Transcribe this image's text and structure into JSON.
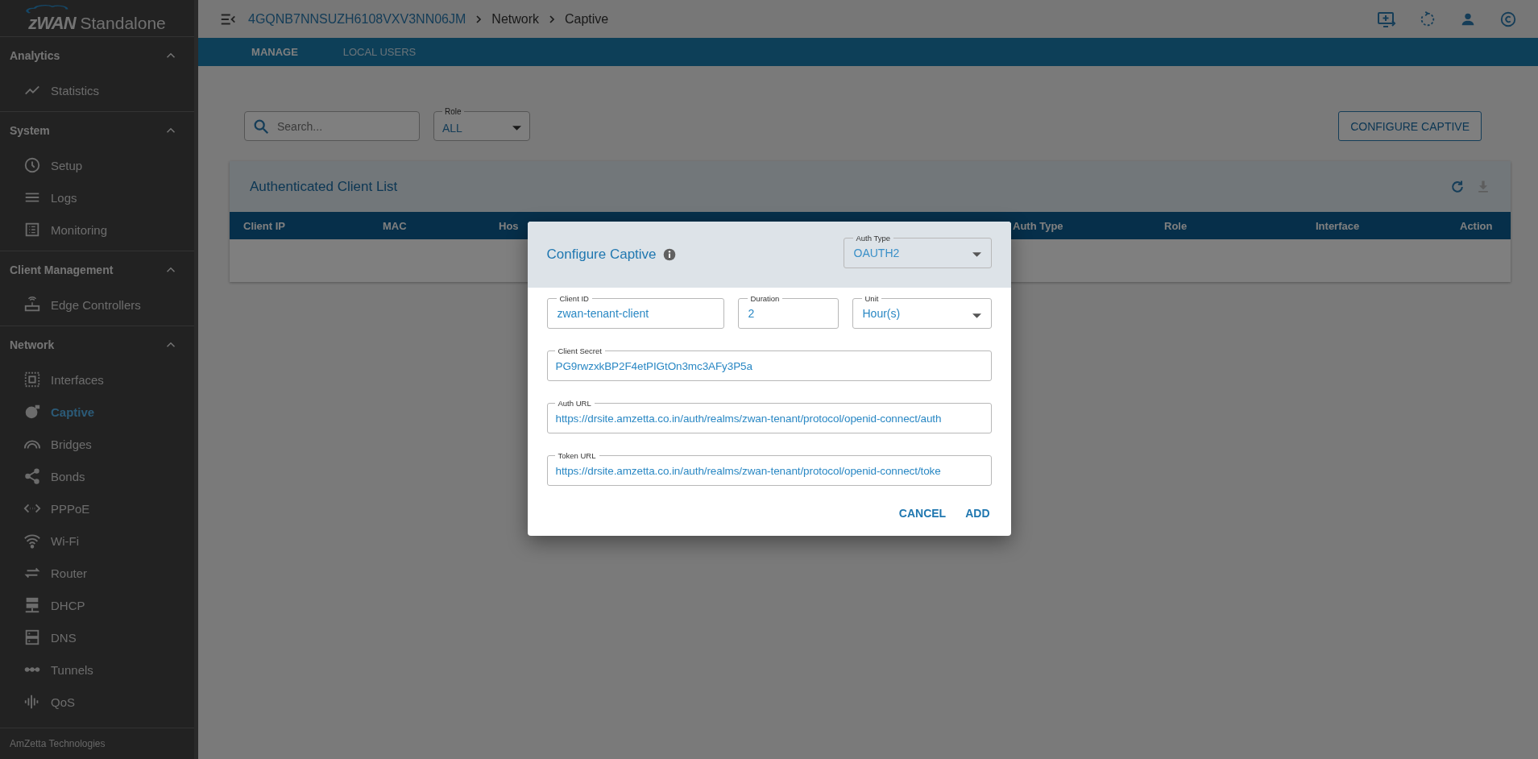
{
  "sidebar": {
    "logo": {
      "brand": "zWAN",
      "product": "Standalone"
    },
    "groups": [
      {
        "title": "Analytics",
        "expanded": true,
        "items": [
          {
            "label": "Statistics",
            "selected": false
          }
        ]
      },
      {
        "title": "System",
        "expanded": true,
        "items": [
          {
            "label": "Setup",
            "selected": false
          },
          {
            "label": "Logs",
            "selected": false
          },
          {
            "label": "Monitoring",
            "selected": false
          }
        ]
      },
      {
        "title": "Client Management",
        "expanded": true,
        "items": [
          {
            "label": "Edge Controllers",
            "selected": false
          }
        ]
      },
      {
        "title": "Network",
        "expanded": true,
        "items": [
          {
            "label": "Interfaces",
            "selected": false
          },
          {
            "label": "Captive",
            "selected": true
          },
          {
            "label": "Bridges",
            "selected": false
          },
          {
            "label": "Bonds",
            "selected": false
          },
          {
            "label": "PPPoE",
            "selected": false
          },
          {
            "label": "Wi-Fi",
            "selected": false
          },
          {
            "label": "Router",
            "selected": false
          },
          {
            "label": "DHCP",
            "selected": false
          },
          {
            "label": "DNS",
            "selected": false
          },
          {
            "label": "Tunnels",
            "selected": false
          },
          {
            "label": "QoS",
            "selected": false
          }
        ]
      }
    ],
    "footer": "AmZetta Technologies"
  },
  "header": {
    "breadcrumb": [
      {
        "label": "4GQNB7NNSUZH6108VXV3NN06JM",
        "kind": "link"
      },
      {
        "label": "Network",
        "kind": "text"
      },
      {
        "label": "Captive",
        "kind": "text"
      }
    ]
  },
  "tabs": [
    {
      "label": "MANAGE",
      "selected": true
    },
    {
      "label": "LOCAL USERS",
      "selected": false
    }
  ],
  "toolbar": {
    "search": {
      "placeholder": "Search..."
    },
    "role": {
      "label": "Role",
      "value": "ALL"
    },
    "configure_button": "CONFIGURE CAPTIVE"
  },
  "card": {
    "title": "Authenticated Client List",
    "columns": [
      "Client IP",
      "MAC",
      "Hos",
      "Auth Type",
      "Role",
      "Interface",
      "Action"
    ]
  },
  "modal": {
    "title": "Configure Captive",
    "auth_type": {
      "label": "Auth Type",
      "value": "OAUTH2"
    },
    "rows": [
      [
        {
          "label": "Client ID",
          "value": "zwan-tenant-client",
          "kind": "text"
        },
        {
          "label": "Duration",
          "value": "2",
          "kind": "text"
        },
        {
          "label": "Unit",
          "value": "Hour(s)",
          "kind": "select"
        }
      ],
      [
        {
          "label": "Client Secret",
          "value": "PG9rwzxkBP2F4etPIGtOn3mc3AFy3P5a",
          "kind": "text"
        }
      ],
      [
        {
          "label": "Auth URL",
          "value": "https://drsite.amzetta.co.in/auth/realms/zwan-tenant/protocol/openid-connect/auth",
          "kind": "text"
        }
      ],
      [
        {
          "label": "Token URL",
          "value": "https://drsite.amzetta.co.in/auth/realms/zwan-tenant/protocol/openid-connect/toke",
          "kind": "text"
        }
      ]
    ],
    "buttons": [
      "CANCEL",
      "ADD"
    ]
  }
}
